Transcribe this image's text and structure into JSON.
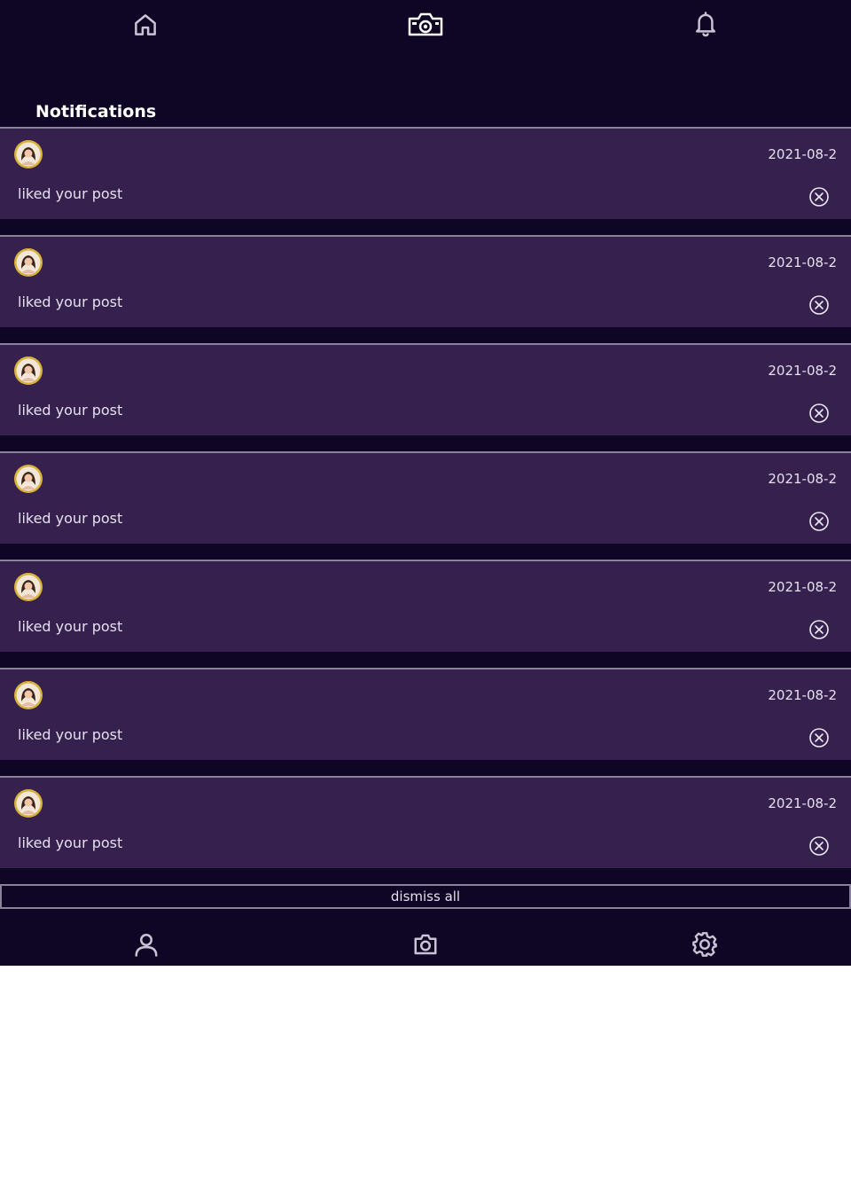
{
  "header": {
    "title": "Notifications",
    "icons": [
      "home-icon",
      "camera-logo-icon",
      "bell-icon"
    ]
  },
  "notifications": [
    {
      "text": "liked your post",
      "date": "2021-08-2"
    },
    {
      "text": "liked your post",
      "date": "2021-08-2"
    },
    {
      "text": "liked your post",
      "date": "2021-08-2"
    },
    {
      "text": "liked your post",
      "date": "2021-08-2"
    },
    {
      "text": "liked your post",
      "date": "2021-08-2"
    },
    {
      "text": "liked your post",
      "date": "2021-08-2"
    },
    {
      "text": "liked your post",
      "date": "2021-08-2"
    }
  ],
  "actions": {
    "dismiss_all_label": "dismiss all"
  },
  "bottom_nav": {
    "icons": [
      "user-icon",
      "camera-icon",
      "gear-icon"
    ]
  },
  "colors": {
    "background": "#0e0624",
    "card": "#35204e",
    "divider": "#8a8298",
    "text": "#e6e0ee",
    "avatar_ring": "#d9b23a"
  }
}
